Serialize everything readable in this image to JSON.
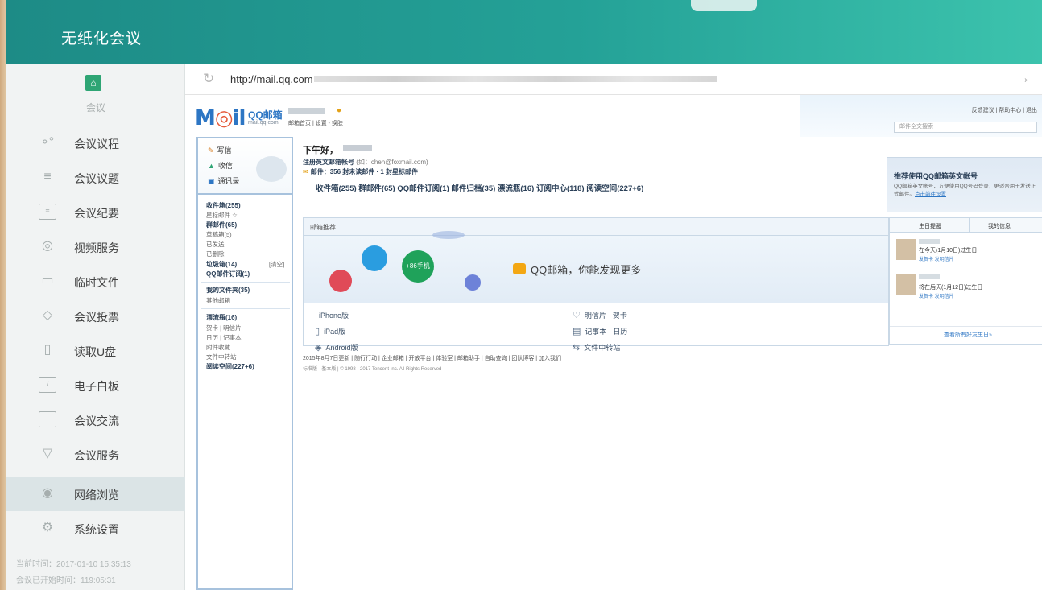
{
  "app": {
    "title": "无纸化会议"
  },
  "sidebar": {
    "home_label": "会议",
    "items": [
      {
        "label": "会议议程",
        "icon": "agenda-icon"
      },
      {
        "label": "会议议题",
        "icon": "topics-icon"
      },
      {
        "label": "会议纪要",
        "icon": "minutes-icon"
      },
      {
        "label": "视频服务",
        "icon": "video-icon"
      },
      {
        "label": "临时文件",
        "icon": "folder-icon"
      },
      {
        "label": "会议投票",
        "icon": "vote-icon"
      },
      {
        "label": "读取U盘",
        "icon": "usb-icon"
      },
      {
        "label": "电子白板",
        "icon": "whiteboard-icon"
      },
      {
        "label": "会议交流",
        "icon": "chat-icon"
      },
      {
        "label": "会议服务",
        "icon": "service-icon"
      },
      {
        "label": "网络浏览",
        "icon": "globe-icon"
      },
      {
        "label": "系统设置",
        "icon": "gear-icon"
      }
    ],
    "active_item": "网络浏览",
    "current_time": "当前时间：2017-01-10 15:35:13",
    "elapsed_time": "会议已开始时间：119:05:31"
  },
  "browser": {
    "url": "http://mail.qq.com"
  },
  "mail": {
    "logo_text": "QQ邮箱",
    "logo_domain": "mail.qq.com",
    "account_links": "邮箱首页 | 设置 - 换肤",
    "top_links": "反馈建议 | 帮助中心 | 退出",
    "search_placeholder": "邮件全文搜索",
    "quick": {
      "write": "写信",
      "receive": "收信",
      "contacts": "通讯录"
    },
    "folders": [
      "收件箱(255)",
      "星标邮件 ☆",
      "群邮件(65)",
      "草稿箱(5)",
      "已发送",
      "已删除",
      "垃圾箱(14)",
      "[清空]",
      "QQ邮件订阅(1)",
      "我的文件夹(35)",
      "其他邮箱",
      "漂流瓶(16)",
      "贺卡 | 明信片",
      "日历 | 记事本",
      "附件收藏",
      "文件中转站",
      "阅读空间(227+6)"
    ],
    "greeting": "下午好，",
    "register_tip": "注册英文邮箱帐号",
    "register_example": "(如：chen@foxmail.com)",
    "stats": "邮件：356 封未读邮件 · 1 封星标邮件",
    "links_row": "收件箱(255)  群邮件(65)  QQ邮件订阅(1)  邮件归档(35)  漂流瓶(16)  订阅中心(118)  阅读空间(227+6)",
    "recommend_title": "邮箱推荐",
    "slogan": "QQ邮箱，你能发现更多",
    "recommend_items": [
      "iPhone版",
      "明信片 · 贺卡",
      "iPad版",
      "记事本 · 日历",
      "Android版",
      "文件中转站"
    ],
    "footer_links": "2015年8月7日更新 | 随行行动 | 企业邮箱 | 开放平台 | 体验室 | 邮箱助手 | 自助查询 | 团队博客 | 加入我们",
    "footer_copy": "标准版 · 基本版 | © 1998 - 2017 Tencent Inc. All Rights Reserved",
    "right_ad_title": "推荐使用QQ邮箱英文帐号",
    "right_ad_text": "QQ邮箱英文帐号，方便使用QQ号码登录，更适合用于发送正式邮件。",
    "right_ad_link": "点击前往设置",
    "birthday_tab": "生日提醒",
    "messages_tab": "我的信息",
    "birthdays": [
      {
        "text": "在今天(1月10日)过生日",
        "actions": "发贺卡  发明信片"
      },
      {
        "text": "将在后天(1月12日)过生日",
        "actions": "发贺卡  发明信片"
      }
    ],
    "birthday_all": "查看所有好友生日»",
    "banner_bubble": "+86手机"
  }
}
